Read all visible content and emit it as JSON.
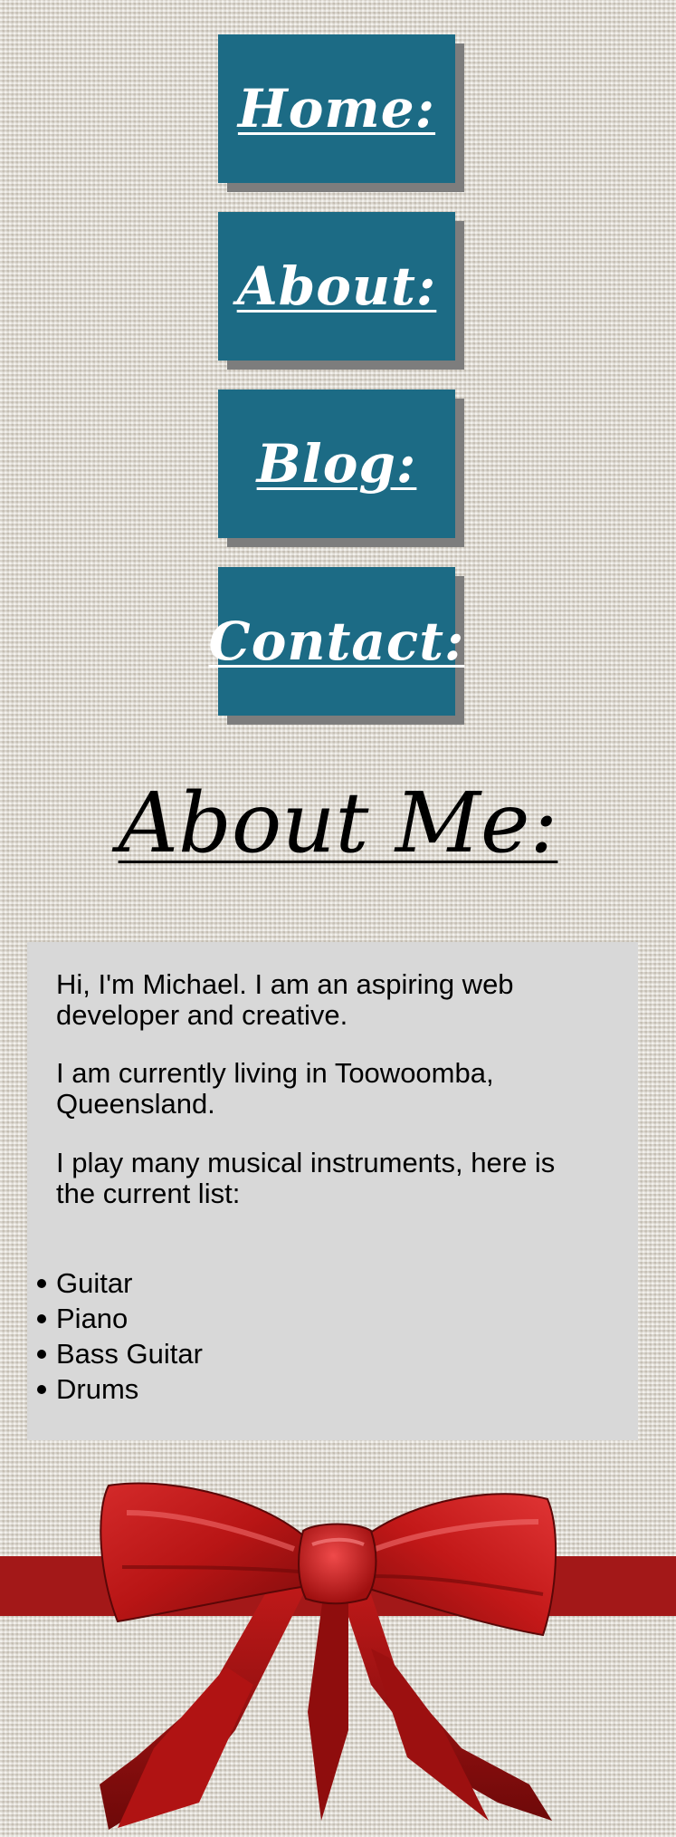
{
  "nav": {
    "home": "Home:",
    "about": "About:",
    "blog": "Blog:",
    "contact": "Contact:"
  },
  "heading": "About Me:",
  "intro": {
    "p1": "Hi, I'm Michael. I am an aspiring web developer and creative.",
    "p2": "I am currently living in Toowoomba, Queensland.",
    "p3": "I play many musical instruments, here is the current list:"
  },
  "instruments": [
    "Guitar",
    "Piano",
    "Bass Guitar",
    "Drums"
  ],
  "colors": {
    "nav_button": "#1c6b85",
    "nav_shadow": "#7d7d7d",
    "panel": "#d8d8d8",
    "ribbon": "#a31818",
    "background": "#e6e2da"
  },
  "decoration": {
    "bow": "red-ribbon-bow"
  }
}
